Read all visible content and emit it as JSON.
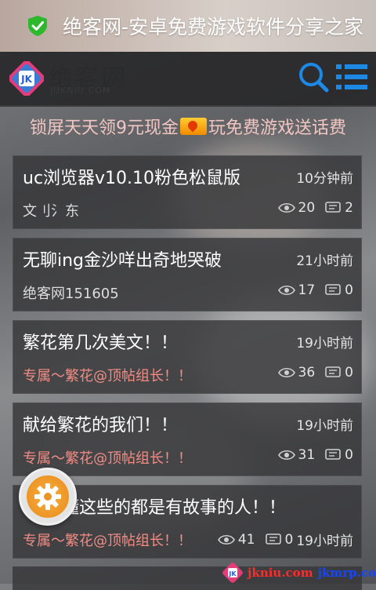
{
  "titlebar": {
    "text": "绝客网-安卓免费游戏软件分享之家",
    "icon": "shield-check-icon"
  },
  "header": {
    "logo_text": "绝客网",
    "logo_sub": "JUKNIU.COM",
    "search_icon": "search-icon",
    "menu_icon": "list-menu-icon"
  },
  "banner": {
    "text_before": "锁屏天天领9元现金",
    "text_after": "玩免费游戏送话费",
    "badge_icon": "fire-icon"
  },
  "posts": [
    {
      "title": "uc浏览器v10.10粉色松鼠版",
      "time": "10分钟前",
      "author": "文刂氵东",
      "views": "20",
      "comments": "2"
    },
    {
      "title": "无聊ing金沙咩出奇地哭破",
      "time": "21小时前",
      "author": "绝客网151605",
      "views": "17",
      "comments": "0"
    },
    {
      "title": "繁花第几次美文！！",
      "time": "19小时前",
      "author": "专属～繁花@顶帖组长！！",
      "views": "36",
      "comments": "0"
    },
    {
      "title": "献给繁花的我们！！",
      "time": "19小时前",
      "author": "专属～繁花@顶帖组长！！",
      "views": "31",
      "comments": "0"
    },
    {
      "title": "懂这些的都是有故事的人！！",
      "time": "19小时前",
      "author": "专属～繁花@顶帖组长！！",
      "views": "41",
      "comments": "0"
    }
  ],
  "fab": {
    "icon": "gear-icon"
  },
  "watermark": {
    "part1": "jkniu.com",
    "part2": "jkmrp.com"
  },
  "colors": {
    "special_author": "#f08c84",
    "banner_text": "#f1c6c2",
    "accent_blue": "#1e88e5",
    "fab_orange": "#e88a1b"
  }
}
